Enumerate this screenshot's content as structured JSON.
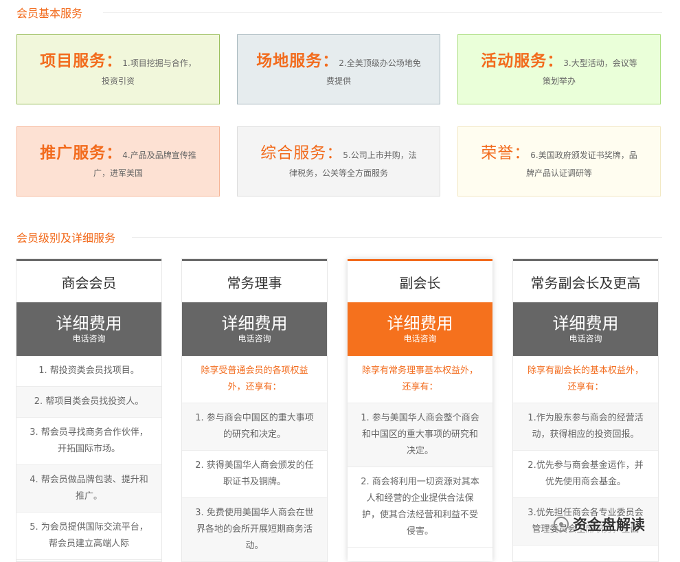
{
  "basic_services": {
    "title": "会员基本服务",
    "items": [
      {
        "title": "项目服务：",
        "desc": "1.项目挖掘与合作，",
        "desc2": "投资引资",
        "bg": "#f1f7db",
        "border": "#9bbf5c"
      },
      {
        "title": "场地服务：",
        "desc": "2.全美顶级办公场地免",
        "desc2": "费提供",
        "bg": "#e6ecee",
        "border": "#a9b9bf"
      },
      {
        "title": "活动服务：",
        "desc": "3.大型活动，会议等",
        "desc2": "策划举办",
        "bg": "#eaffd9",
        "border": "#a9df7c"
      },
      {
        "title": "推广服务：",
        "desc": "4.产品及品牌宣传推",
        "desc2": "广，进军美国",
        "bg": "#fde1d3",
        "border": "#f6b496"
      },
      {
        "title": "综合服务：",
        "desc": "5.公司上市并购，法",
        "desc2": "律税务，公关等全方面服务",
        "bg": "#f4f4f4",
        "border": "#dddddd"
      },
      {
        "title": "荣誉：",
        "desc": "6.美国政府颁发证书奖牌，品",
        "desc2": "牌产品认证调研等",
        "bg": "#fffdf0",
        "border": "#f2e8c2"
      }
    ]
  },
  "levels": {
    "title": "会员级别及详细服务",
    "cards": [
      {
        "name": "商会会员",
        "price": "详细费用",
        "price_sub": "电话咨询",
        "items": [
          "1. 帮投资类会员找项目。",
          "2. 帮项目类会员找投资人。",
          "3. 帮会员寻找商务合作伙伴，开拓国际市场。",
          "4. 帮会员做品牌包装、提升和推广。",
          "5. 为会员提供国际交流平台，帮会员建立高端人际"
        ]
      },
      {
        "name": "常务理事",
        "price": "详细费用",
        "price_sub": "电话咨询",
        "intro": "除享受普通会员的各项权益外，还享有：",
        "items": [
          "1. 参与商会中国区的重大事项的研究和决定。",
          "2. 获得美国华人商会颁发的任职证书及铜牌。",
          "3. 免费使用美国华人商会在世界各地的会所开展短期商务活动。"
        ]
      },
      {
        "name": "副会长",
        "price": "详细费用",
        "price_sub": "电话咨询",
        "intro": "除享有常务理事基本权益外，还享有：",
        "items": [
          "1. 参与美国华人商会整个商会和中国区的重大事项的研究和决定。",
          "2. 商会将利用一切资源对其本人和经营的企业提供合法保护，使其合法经营和利益不受侵害。"
        ]
      },
      {
        "name": "常务副会长及更高",
        "price": "详细费用",
        "price_sub": "电话咨询",
        "intro": "除享有副会长的基本权益外，还享有：",
        "items": [
          "1.作为股东参与商会的经营活动，获得相应的投资回报。",
          "2.优先参与商会基金运作，并优先使用商会基金。",
          "3.优先担任商会各专业委员会管理委员会主席职务，全面"
        ]
      }
    ]
  },
  "watermark": {
    "text": "资金盘解读",
    "icon": "wechat-official-account-icon"
  }
}
